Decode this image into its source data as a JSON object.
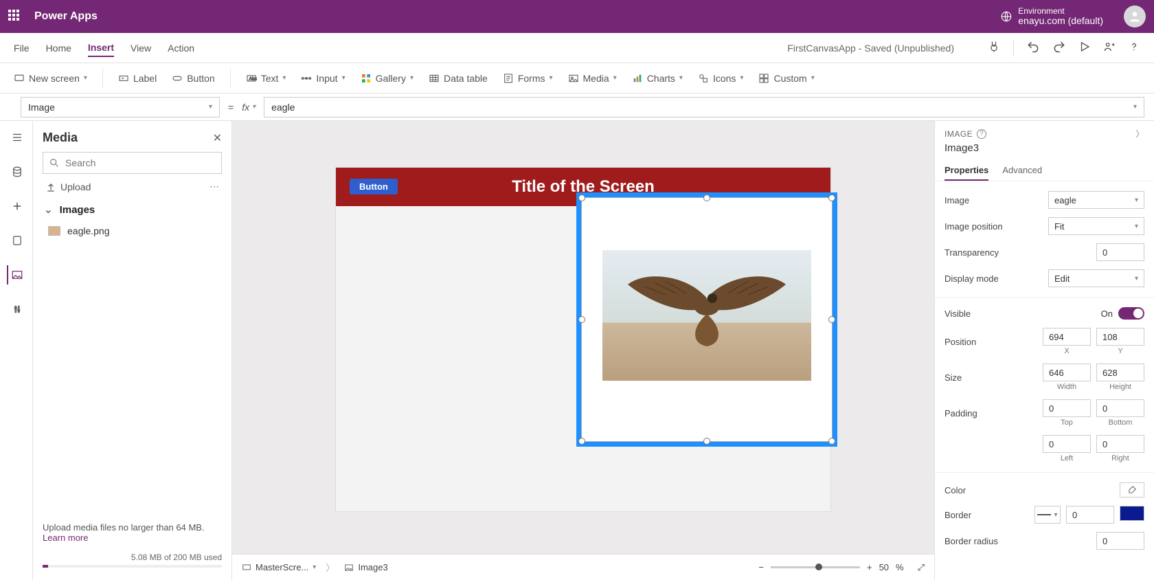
{
  "header": {
    "app_name": "Power Apps",
    "env_label": "Environment",
    "env_value": "enayu.com (default)"
  },
  "menu": {
    "items": [
      "File",
      "Home",
      "Insert",
      "View",
      "Action"
    ],
    "active_index": 2,
    "doc_status": "FirstCanvasApp - Saved (Unpublished)"
  },
  "ribbon": {
    "new_screen": "New screen",
    "label": "Label",
    "button": "Button",
    "text": "Text",
    "input": "Input",
    "gallery": "Gallery",
    "data_table": "Data table",
    "forms": "Forms",
    "media": "Media",
    "charts": "Charts",
    "icons": "Icons",
    "custom": "Custom"
  },
  "formula": {
    "property": "Image",
    "value": "eagle"
  },
  "media_panel": {
    "title": "Media",
    "search_placeholder": "Search",
    "upload": "Upload",
    "images_header": "Images",
    "items": [
      {
        "name": "eagle.png"
      }
    ],
    "footer_note": "Upload media files no larger than 64 MB.",
    "learn_more": "Learn more",
    "storage": "5.08 MB of 200 MB used"
  },
  "canvas": {
    "screen_title": "Title of the Screen",
    "button_label": "Button",
    "breadcrumb_screen": "MasterScre...",
    "breadcrumb_image": "Image3",
    "zoom_value": "50",
    "zoom_unit": "%"
  },
  "props": {
    "category": "IMAGE",
    "name": "Image3",
    "tabs": {
      "properties": "Properties",
      "advanced": "Advanced"
    },
    "image_label": "Image",
    "image_value": "eagle",
    "pos_label": "Image position",
    "pos_value": "Fit",
    "transparency_label": "Transparency",
    "transparency_value": "0",
    "display_mode_label": "Display mode",
    "display_mode_value": "Edit",
    "visible_label": "Visible",
    "visible_on": "On",
    "position_label": "Position",
    "pos_x": "694",
    "pos_y": "108",
    "pos_x_lbl": "X",
    "pos_y_lbl": "Y",
    "size_label": "Size",
    "size_w": "646",
    "size_h": "628",
    "size_w_lbl": "Width",
    "size_h_lbl": "Height",
    "padding_label": "Padding",
    "pad_top": "0",
    "pad_bottom": "0",
    "pad_left": "0",
    "pad_right": "0",
    "pad_top_lbl": "Top",
    "pad_bottom_lbl": "Bottom",
    "pad_left_lbl": "Left",
    "pad_right_lbl": "Right",
    "color_label": "Color",
    "border_label": "Border",
    "border_value": "0",
    "border_radius_label": "Border radius",
    "border_radius_value": "0"
  }
}
